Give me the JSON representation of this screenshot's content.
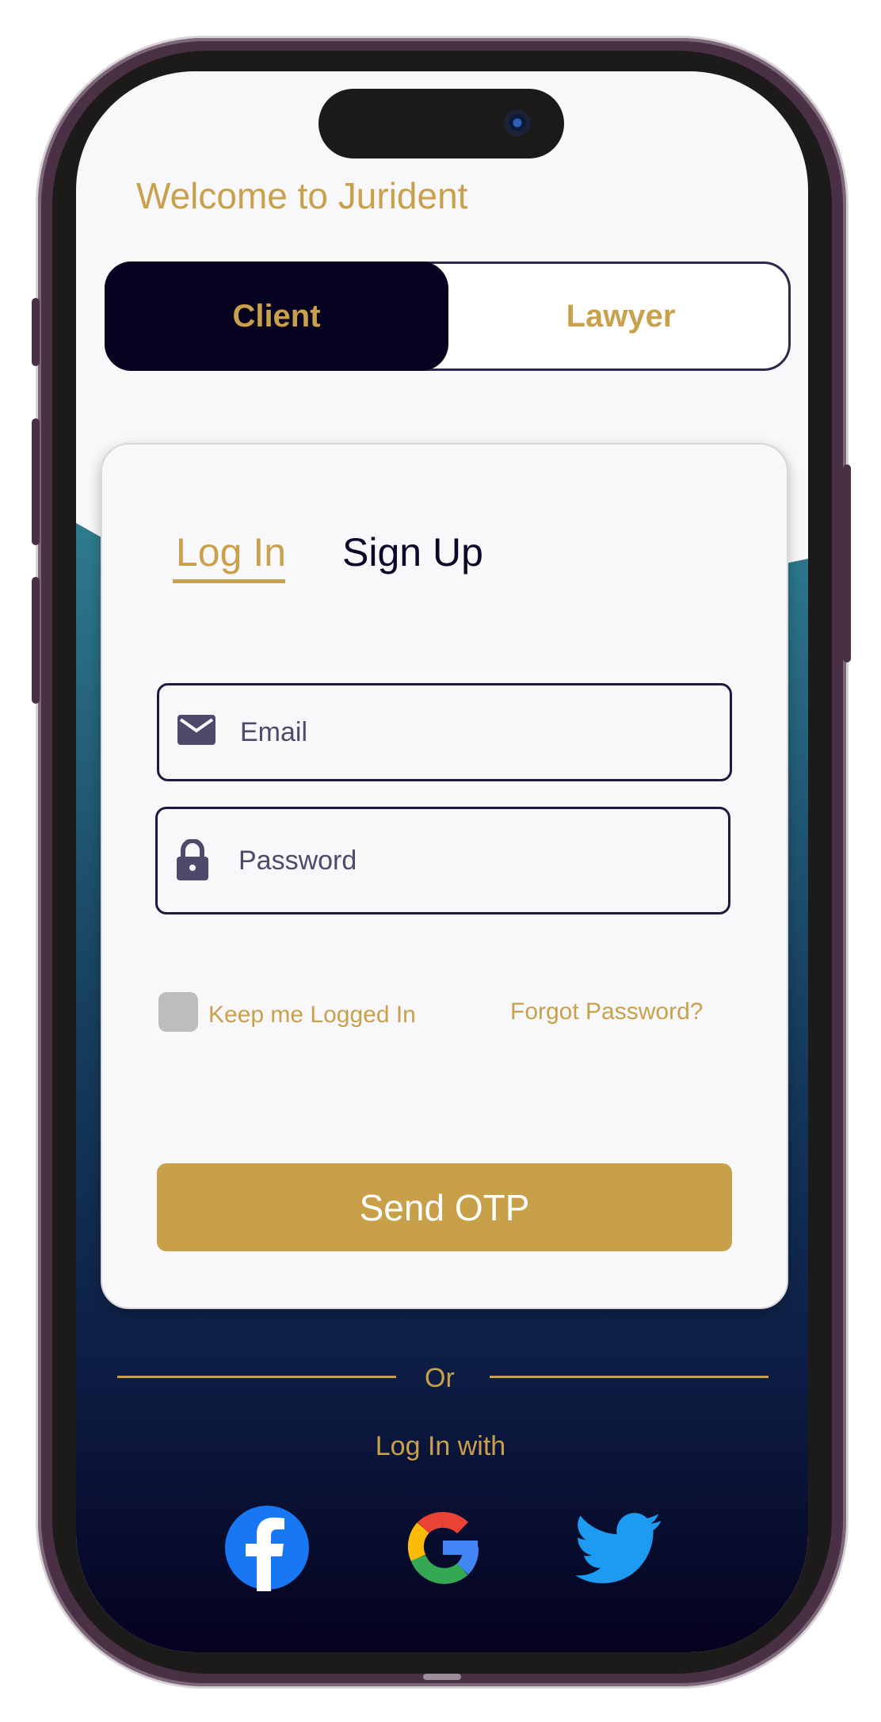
{
  "header": {
    "welcome_text": "Welcome to Jurident"
  },
  "role_toggle": {
    "client_label": "Client",
    "lawyer_label": "Lawyer",
    "selected": "Client"
  },
  "auth_tabs": {
    "login_label": "Log In",
    "signup_label": "Sign Up",
    "active": "Log In"
  },
  "form": {
    "email_placeholder": "Email",
    "password_placeholder": "Password",
    "keep_logged_in_label": "Keep me Logged In",
    "keep_logged_in_checked": false,
    "forgot_password_label": "Forgot Password?",
    "submit_label": "Send OTP"
  },
  "alt_login": {
    "or_text": "Or",
    "login_with_text": "Log In with",
    "providers": [
      {
        "name": "facebook-icon"
      },
      {
        "name": "google-icon"
      },
      {
        "name": "twitter-icon"
      }
    ]
  },
  "colors": {
    "accent_gold": "#c9a04c",
    "navy": "#06021f",
    "gradient_top": "#2f7b8e",
    "gradient_bottom": "#05021f"
  }
}
